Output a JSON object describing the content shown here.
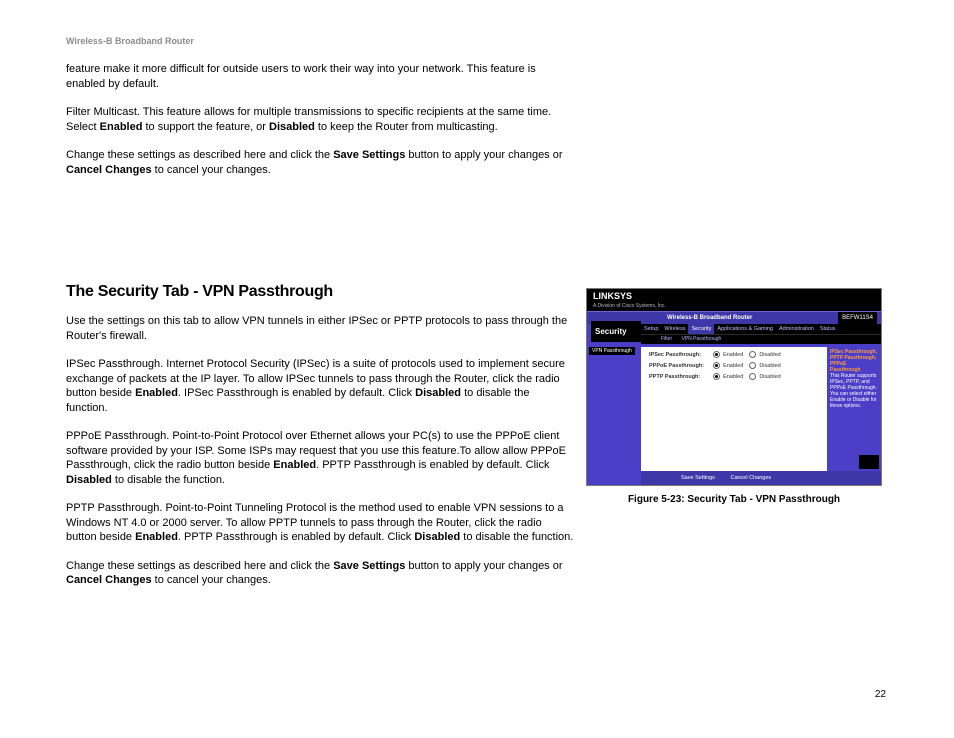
{
  "header": {
    "product": "Wireless-B Broadband Router"
  },
  "intro": {
    "p1": "feature make it more difficult for outside users to work their way into your network. This feature is enabled by default.",
    "p2a": "Filter Multicast. This feature allows for multiple transmissions to specific recipients at the same time.  Select ",
    "p2b": "Enabled",
    "p2c": " to support the feature, or ",
    "p2d": "Disabled",
    "p2e": " to keep the Router from multicasting.",
    "p3a": "Change these settings as described here and click the ",
    "p3b": "Save Settings",
    "p3c": " button to apply your changes or ",
    "p3d": "Cancel Changes",
    "p3e": " to cancel your changes."
  },
  "section": {
    "title": "The Security Tab - VPN Passthrough",
    "p1": "Use the settings on this tab to allow VPN tunnels in either IPSec or PPTP protocols to pass through the Router's firewall.",
    "p2a": "IPSec Passthrough. Internet Protocol Security (IPSec) is a suite of protocols used to implement secure exchange of packets at the IP layer. To allow IPSec tunnels to pass through the Router, click the radio button beside ",
    "p2b": "Enabled",
    "p2c": ". IPSec Passthrough is enabled by default. Click ",
    "p2d": "Disabled",
    "p2e": " to disable the function.",
    "p3a": "PPPoE Passthrough. Point-to-Point Protocol over Ethernet allows your PC(s) to use the PPPoE client software provided by your ISP. Some ISPs may request that you use this feature.To allow allow PPPoE Passthrough, click the radio button beside ",
    "p3b": "Enabled",
    "p3c": ". PPTP Passthrough is enabled by default. Click ",
    "p3d": "Disabled",
    "p3e": " to disable the function.",
    "p4a": "PPTP Passthrough. Point-to-Point Tunneling Protocol is the method used to enable VPN sessions to a Windows NT 4.0 or 2000 server. To allow PPTP tunnels to pass through the Router, click the radio button beside ",
    "p4b": "Enabled",
    "p4c": ". PPTP Passthrough is enabled by default. Click ",
    "p4d": "Disabled",
    "p4e": " to disable the function.",
    "p5a": "Change these settings as described here and click the ",
    "p5b": "Save Settings",
    "p5c": " button to apply your changes or ",
    "p5d": "Cancel Changes",
    "p5e": " to cancel your changes."
  },
  "figure": {
    "caption": "Figure 5-23: Security Tab - VPN Passthrough",
    "brand": "LINKSYS",
    "brand_sub": "A Division of Cisco Systems, Inc.",
    "titlebar_center": "Wireless-B Broadband Router",
    "model": "BEFW11S4",
    "left_label": "Security",
    "tabs": [
      "Setup",
      "Wireless",
      "Security",
      "Applications & Gaming",
      "Administration",
      "Status"
    ],
    "subtabs": [
      "Filter",
      "VPN Passthrough"
    ],
    "chip": "VPN Passthrough",
    "rows": [
      {
        "label": "IPSec Passthrough:",
        "enabled": "Enabled",
        "disabled": "Disabled",
        "value": "enabled"
      },
      {
        "label": "PPPoE Passthrough:",
        "enabled": "Enabled",
        "disabled": "Disabled",
        "value": "enabled"
      },
      {
        "label": "PPTP Passthrough:",
        "enabled": "Enabled",
        "disabled": "Disabled",
        "value": "enabled"
      }
    ],
    "help_title": "IPSec Passthrough, PPTP Passthrough, PPPoE Passthrough",
    "help_body": "This Router supports IPSec, PPTP, and PPPoE Passthrough. You can select either Enable or Disable for these options.",
    "footer_save": "Save Settings",
    "footer_cancel": "Cancel Changes"
  },
  "page_number": "22"
}
